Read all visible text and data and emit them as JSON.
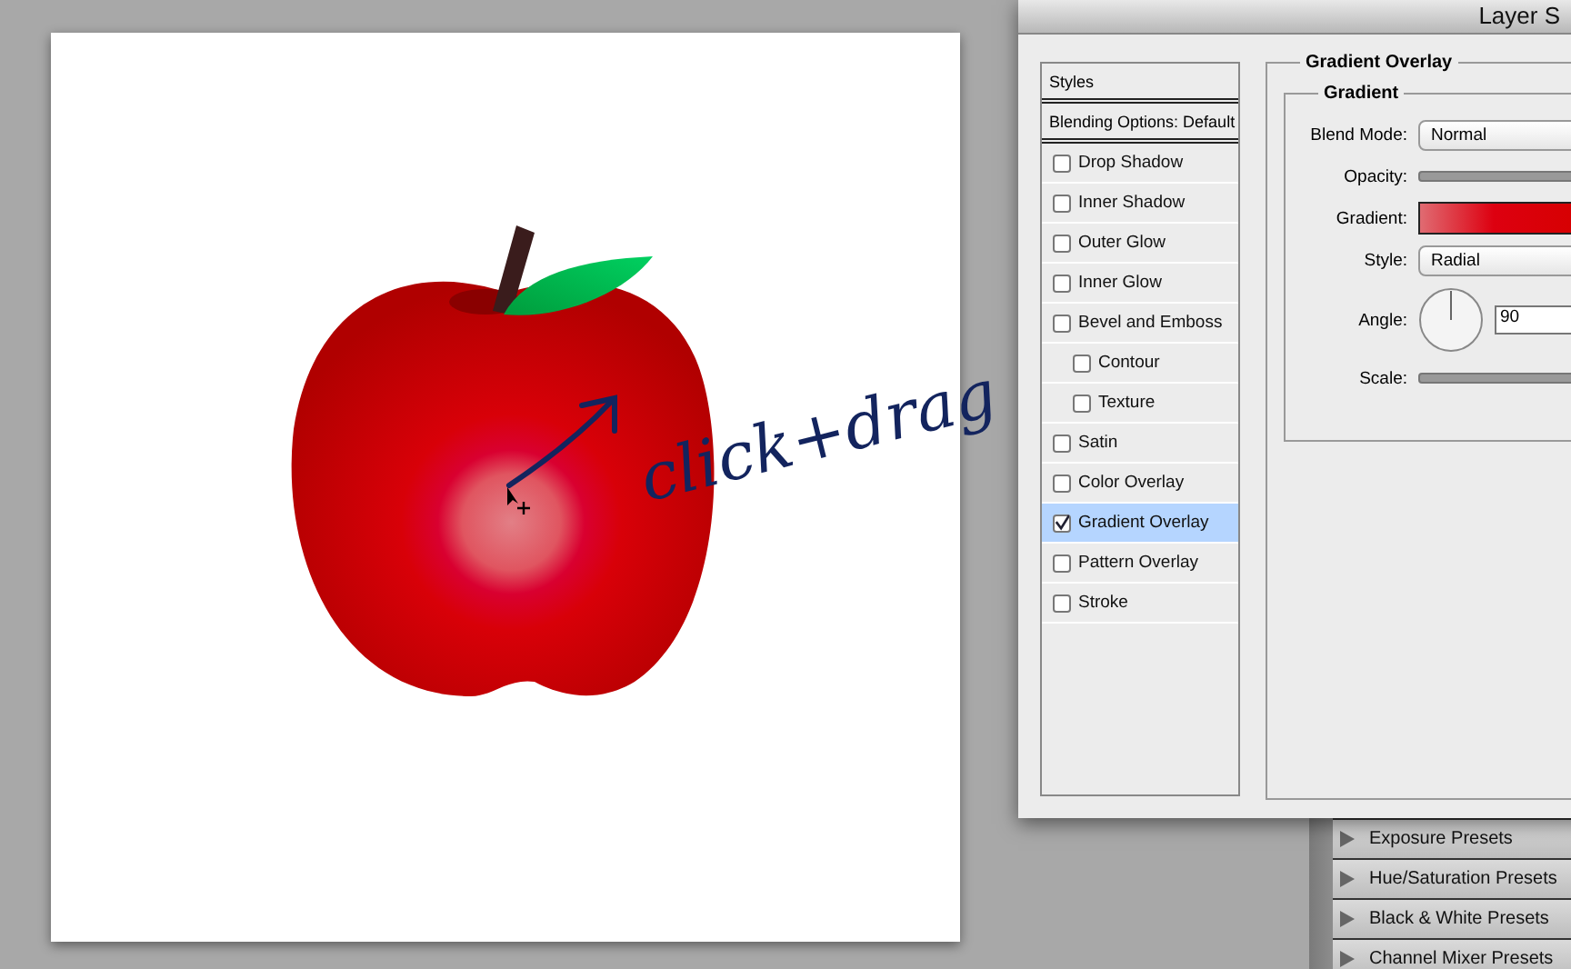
{
  "canvas": {
    "annotation": "click+drag"
  },
  "dialog": {
    "title": "Layer S",
    "styles_list": {
      "header": "Styles",
      "blending": "Blending Options: Default",
      "items": [
        {
          "label": "Drop Shadow",
          "checked": false,
          "selected": false
        },
        {
          "label": "Inner Shadow",
          "checked": false,
          "selected": false
        },
        {
          "label": "Outer Glow",
          "checked": false,
          "selected": false
        },
        {
          "label": "Inner Glow",
          "checked": false,
          "selected": false
        },
        {
          "label": "Bevel and Emboss",
          "checked": false,
          "selected": false,
          "children": [
            {
              "label": "Contour",
              "checked": false,
              "selected": false
            },
            {
              "label": "Texture",
              "checked": false,
              "selected": false
            }
          ]
        },
        {
          "label": "Satin",
          "checked": false,
          "selected": false
        },
        {
          "label": "Color Overlay",
          "checked": false,
          "selected": false
        },
        {
          "label": "Gradient Overlay",
          "checked": true,
          "selected": true
        },
        {
          "label": "Pattern Overlay",
          "checked": false,
          "selected": false
        },
        {
          "label": "Stroke",
          "checked": false,
          "selected": false
        }
      ]
    },
    "panel": {
      "title": "Gradient Overlay",
      "group": "Gradient",
      "fields": [
        {
          "kind": "select",
          "label": "Blend Mode:",
          "value": "Normal"
        },
        {
          "kind": "slider",
          "label": "Opacity:"
        },
        {
          "kind": "gradient",
          "label": "Gradient:"
        },
        {
          "kind": "select",
          "label": "Style:",
          "value": "Radial"
        },
        {
          "kind": "angle",
          "label": "Angle:",
          "value": "90"
        },
        {
          "kind": "slider",
          "label": "Scale:"
        }
      ]
    }
  },
  "presets": [
    "Exposure Presets",
    "Hue/Saturation Presets",
    "Black & White Presets",
    "Channel Mixer Presets"
  ]
}
